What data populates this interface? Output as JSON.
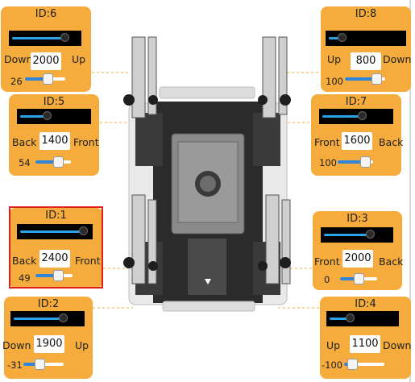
{
  "accent": "#f5ac3c",
  "bar_color": "#29a3e6",
  "selection_color": "#e0201c",
  "servos": [
    {
      "id_label": "ID:6",
      "left_label": "Down",
      "value": "2000",
      "right_label": "Up",
      "offset": "26",
      "offset_fraction": 0.6,
      "bar_fraction": 0.83
    },
    {
      "id_label": "ID:8",
      "left_label": "Up",
      "value": "800",
      "right_label": "Down",
      "offset": "100",
      "offset_fraction": 0.9,
      "bar_fraction": 0.16
    },
    {
      "id_label": "ID:5",
      "left_label": "Back",
      "value": "1400",
      "right_label": "Front",
      "offset": "54",
      "offset_fraction": 0.7,
      "bar_fraction": 0.4
    },
    {
      "id_label": "ID:7",
      "left_label": "Front",
      "value": "1600",
      "right_label": "Back",
      "offset": "100",
      "offset_fraction": 0.9,
      "bar_fraction": 0.6
    },
    {
      "id_label": "ID:1",
      "left_label": "Back",
      "value": "2400",
      "right_label": "Front",
      "offset": "49",
      "offset_fraction": 0.68,
      "bar_fraction": 0.95
    },
    {
      "id_label": "ID:3",
      "left_label": "Front",
      "value": "2000",
      "right_label": "Back",
      "offset": "0",
      "offset_fraction": 0.5,
      "bar_fraction": 0.72
    },
    {
      "id_label": "ID:2",
      "left_label": "Down",
      "value": "1900",
      "right_label": "Up",
      "offset": "-31",
      "offset_fraction": 0.38,
      "bar_fraction": 0.76
    },
    {
      "id_label": "ID:4",
      "left_label": "Up",
      "value": "1100",
      "right_label": "Down",
      "offset": "-100",
      "offset_fraction": 0.1,
      "bar_fraction": 0.3
    }
  ]
}
